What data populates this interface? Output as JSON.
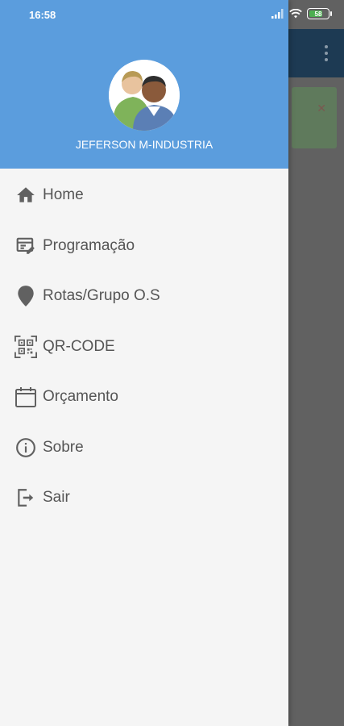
{
  "status_bar": {
    "time": "16:58",
    "battery_level": "58"
  },
  "drawer": {
    "user_name": "JEFERSON M-INDUSTRIA",
    "items": [
      {
        "label": "Home",
        "icon": "home-icon"
      },
      {
        "label": "Programação",
        "icon": "schedule-edit-icon"
      },
      {
        "label": "Rotas/Grupo O.S",
        "icon": "location-pin-icon"
      },
      {
        "label": "QR-CODE",
        "icon": "qr-code-icon"
      },
      {
        "label": "Orçamento",
        "icon": "calendar-icon"
      },
      {
        "label": "Sobre",
        "icon": "info-icon"
      },
      {
        "label": "Sair",
        "icon": "logout-icon"
      }
    ]
  },
  "colors": {
    "header": "#5b9ddd",
    "drawer_bg": "#f5f5f5",
    "scrim": "#616161",
    "app_bar": "#1d3a53",
    "icon": "#616161",
    "label": "#555555"
  }
}
